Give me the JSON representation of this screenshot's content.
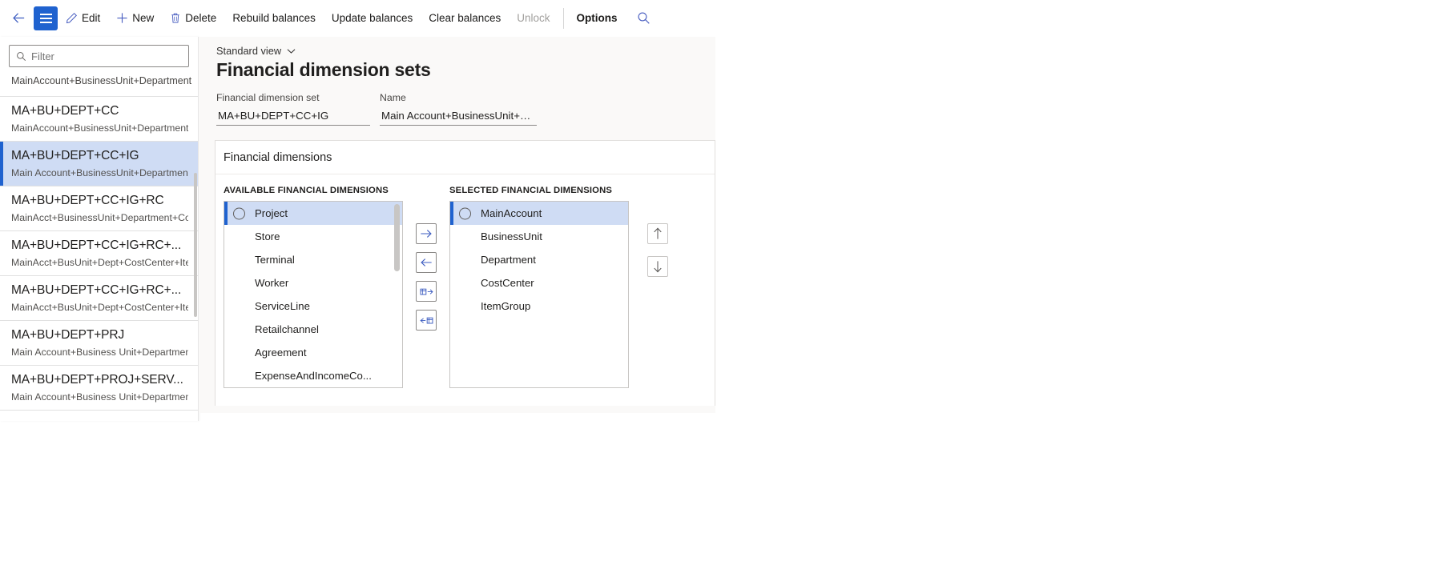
{
  "toolbar": {
    "back_icon": "arrow-left-icon",
    "menu_icon": "hamburger-icon",
    "buttons": [
      {
        "label": "Edit",
        "icon": "pencil-icon",
        "disabled": false,
        "bold": false
      },
      {
        "label": "New",
        "icon": "plus-icon",
        "disabled": false,
        "bold": false
      },
      {
        "label": "Delete",
        "icon": "trash-icon",
        "disabled": false,
        "bold": false
      },
      {
        "label": "Rebuild balances",
        "icon": "",
        "disabled": false,
        "bold": false
      },
      {
        "label": "Update balances",
        "icon": "",
        "disabled": false,
        "bold": false
      },
      {
        "label": "Clear balances",
        "icon": "",
        "disabled": false,
        "bold": false
      },
      {
        "label": "Unlock",
        "icon": "",
        "disabled": true,
        "bold": false
      },
      {
        "label": "Options",
        "icon": "",
        "disabled": false,
        "bold": true
      }
    ],
    "search_icon": "search-icon"
  },
  "sidebar": {
    "filter": {
      "placeholder": "Filter",
      "value": "",
      "icon": "search-icon"
    },
    "partial_top_item": {
      "subtitle": "MainAccount+BusinessUnit+Department"
    },
    "items": [
      {
        "title": "MA+BU+DEPT+CC",
        "subtitle": "MainAccount+BusinessUnit+Department+Co...",
        "selected": false
      },
      {
        "title": "MA+BU+DEPT+CC+IG",
        "subtitle": "Main Account+BusinessUnit+Department+C...",
        "selected": true
      },
      {
        "title": "MA+BU+DEPT+CC+IG+RC",
        "subtitle": "MainAcct+BusinessUnit+Department+CostC...",
        "selected": false
      },
      {
        "title": "MA+BU+DEPT+CC+IG+RC+...",
        "subtitle": "MainAcct+BusUnit+Dept+CostCenter+ItemG...",
        "selected": false
      },
      {
        "title": "MA+BU+DEPT+CC+IG+RC+...",
        "subtitle": "MainAcct+BusUnit+Dept+CostCenter+ItemG...",
        "selected": false
      },
      {
        "title": "MA+BU+DEPT+PRJ",
        "subtitle": "Main Account+Business Unit+Department+P...",
        "selected": false
      },
      {
        "title": "MA+BU+DEPT+PROJ+SERV...",
        "subtitle": "Main Account+Business Unit+Department+...",
        "selected": false
      }
    ]
  },
  "main": {
    "view_selector": {
      "label": "Standard view",
      "icon": "chevron-down-icon"
    },
    "page_title": "Financial dimension sets",
    "fields": [
      {
        "label": "Financial dimension set",
        "value": "MA+BU+DEPT+CC+IG",
        "placeholder": ""
      },
      {
        "label": "Name",
        "value": "Main Account+BusinessUnit+D...",
        "placeholder": ""
      }
    ],
    "card": {
      "title": "Financial dimensions",
      "available_header": "AVAILABLE FINANCIAL DIMENSIONS",
      "selected_header": "SELECTED FINANCIAL DIMENSIONS",
      "available": [
        {
          "label": "Project",
          "selected": true
        },
        {
          "label": "Store",
          "selected": false
        },
        {
          "label": "Terminal",
          "selected": false
        },
        {
          "label": "Worker",
          "selected": false
        },
        {
          "label": "ServiceLine",
          "selected": false
        },
        {
          "label": "Retailchannel",
          "selected": false
        },
        {
          "label": "Agreement",
          "selected": false
        },
        {
          "label": "ExpenseAndIncomeCo...",
          "selected": false
        }
      ],
      "selected": [
        {
          "label": "MainAccount",
          "selected": true
        },
        {
          "label": "BusinessUnit",
          "selected": false
        },
        {
          "label": "Department",
          "selected": false
        },
        {
          "label": "CostCenter",
          "selected": false
        },
        {
          "label": "ItemGroup",
          "selected": false
        }
      ],
      "transfer_buttons": [
        {
          "name": "move-right-button",
          "icon": "arrow-right-icon"
        },
        {
          "name": "move-left-button",
          "icon": "arrow-left-icon"
        },
        {
          "name": "move-all-right-button",
          "icon": "grid-arrow-right-icon"
        },
        {
          "name": "move-all-left-button",
          "icon": "arrow-left-grid-icon"
        }
      ],
      "reorder_buttons": [
        {
          "name": "move-up-button",
          "icon": "arrow-up-icon"
        },
        {
          "name": "move-down-button",
          "icon": "arrow-down-icon"
        }
      ]
    }
  },
  "colors": {
    "accent": "#1f62cf",
    "selection": "#cfdcf4",
    "icon_blue": "#3b5bc0",
    "panel_bg": "#faf9f8"
  }
}
